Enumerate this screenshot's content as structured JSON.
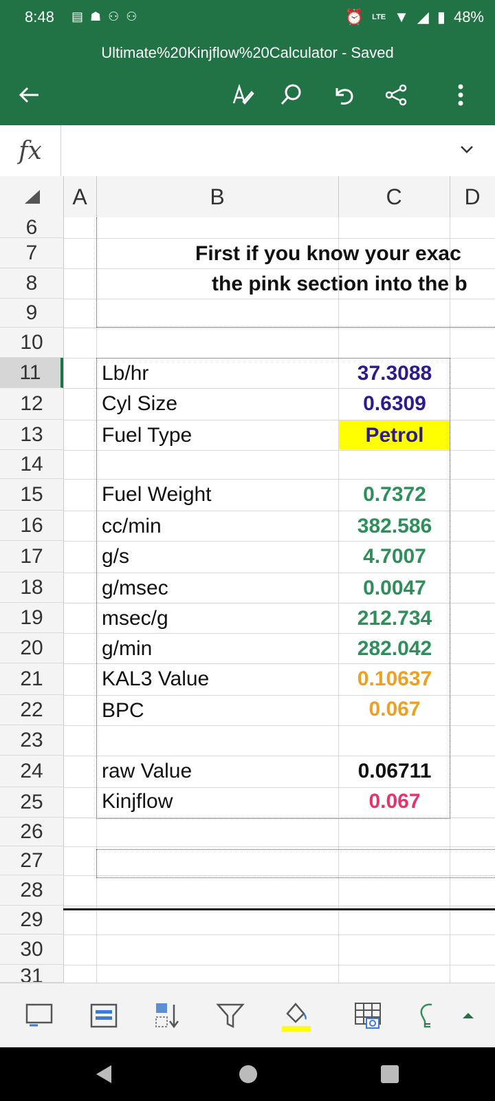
{
  "status": {
    "time": "8:48",
    "battery": "48%",
    "lte": "LTE"
  },
  "header": {
    "title": "Ultimate%20Kinjflow%20Calculator - Saved"
  },
  "formula": {
    "fx": "fx",
    "value": ""
  },
  "columns": [
    "A",
    "B",
    "C",
    "D"
  ],
  "rows": [
    "6",
    "7",
    "8",
    "9",
    "10",
    "11",
    "12",
    "13",
    "14",
    "15",
    "16",
    "17",
    "18",
    "19",
    "20",
    "21",
    "22",
    "23",
    "24",
    "25",
    "26",
    "27",
    "28",
    "29",
    "30",
    "31"
  ],
  "sheet": {
    "heading_line1": "First if you know your exac",
    "heading_line2": "the pink section into the b",
    "labels": [
      "Lb/hr",
      "Cyl Size",
      "Fuel Type",
      "",
      "Fuel Weight",
      "cc/min",
      "g/s",
      "g/msec",
      "msec/g",
      "g/min",
      "KAL3 Value",
      "BPC",
      "",
      "raw Value",
      "Kinjflow"
    ],
    "values": [
      "37.3088",
      "0.6309",
      "Petrol",
      "",
      "0.7372",
      "382.586",
      "4.7007",
      "0.0047",
      "212.734",
      "282.042",
      "0.10637",
      "0.067",
      "",
      "0.06711",
      "0.067"
    ]
  },
  "colors": {
    "excel_green": "#217346",
    "input_blue": "#2e1a8f",
    "result_green": "#2f8f5b",
    "orange": "#f0a020",
    "pink": "#e8336a",
    "yellow": "#ffff00"
  }
}
